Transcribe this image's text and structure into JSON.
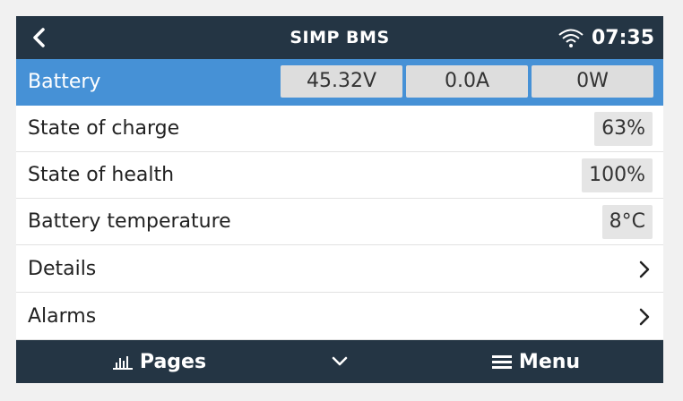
{
  "header": {
    "title": "SIMP BMS",
    "time": "07:35",
    "icons": {
      "back": "chevron-left-icon",
      "wifi": "wifi-icon"
    }
  },
  "battery": {
    "label": "Battery",
    "voltage": "45.32V",
    "current": "0.0A",
    "power": "0W"
  },
  "rows": [
    {
      "label": "State of charge",
      "value": "63%"
    },
    {
      "label": "State of health",
      "value": "100%"
    },
    {
      "label": "Battery temperature",
      "value": "8°C"
    },
    {
      "label": "Details"
    },
    {
      "label": "Alarms"
    }
  ],
  "footer": {
    "pages_label": "Pages",
    "menu_label": "Menu",
    "icons": {
      "pages": "bar-chart-icon",
      "down": "chevron-down-icon",
      "menu": "hamburger-icon"
    }
  },
  "colors": {
    "header_bg": "#243544",
    "accent": "#4691d6",
    "value_bg": "#e5e5e5"
  }
}
